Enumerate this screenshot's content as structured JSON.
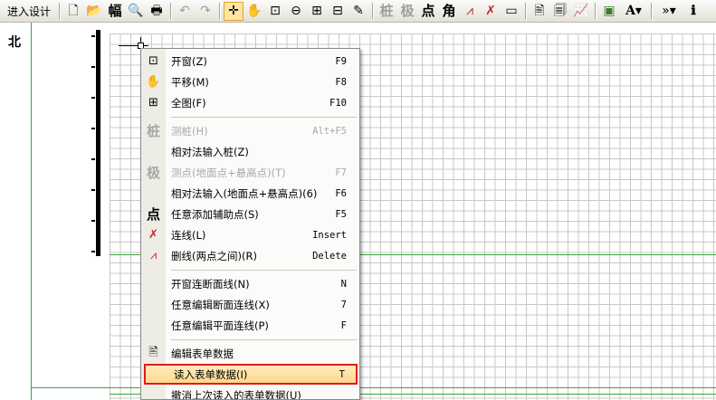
{
  "toolbar": {
    "enter_design_label": "进入设计",
    "buttons": [
      {
        "name": "new-file-icon",
        "glyph": "🗋"
      },
      {
        "name": "open-folder-icon",
        "glyph": "📂"
      },
      {
        "name": "page-format-button",
        "glyph": "幅"
      },
      {
        "name": "print-preview-icon",
        "glyph": "🔍"
      },
      {
        "name": "print-icon",
        "glyph": "🖶"
      },
      {
        "name": "undo-icon",
        "glyph": "↶"
      },
      {
        "name": "redo-icon",
        "glyph": "↷"
      },
      {
        "name": "crosshair-icon",
        "glyph": "✛"
      },
      {
        "name": "pan-hand-icon",
        "glyph": "✋"
      },
      {
        "name": "zoom-window-icon",
        "glyph": "⊡"
      },
      {
        "name": "zoom-out-icon",
        "glyph": "⊖"
      },
      {
        "name": "zoom-extents-icon",
        "glyph": "⊞"
      },
      {
        "name": "full-view-icon",
        "glyph": "⊟"
      },
      {
        "name": "pen-tool-icon",
        "glyph": "✎"
      },
      {
        "name": "pile-button",
        "glyph": "桩"
      },
      {
        "name": "pole-button",
        "glyph": "极"
      },
      {
        "name": "point-button",
        "glyph": "点"
      },
      {
        "name": "angle-button",
        "glyph": "角"
      },
      {
        "name": "delete-line-icon",
        "glyph": "⩘"
      },
      {
        "name": "connect-line-icon",
        "glyph": "✗"
      },
      {
        "name": "ruler-icon",
        "glyph": "▭"
      },
      {
        "name": "edit-table-icon",
        "glyph": "🖹"
      },
      {
        "name": "properties-icon",
        "glyph": "🗐"
      },
      {
        "name": "chart-icon",
        "glyph": "📈"
      },
      {
        "name": "image-icon",
        "glyph": "▣"
      },
      {
        "name": "text-font-icon",
        "glyph": "A▾"
      },
      {
        "name": "more-options-icon",
        "glyph": "»▾"
      },
      {
        "name": "info-icon",
        "glyph": "ℹ"
      }
    ]
  },
  "canvas": {
    "north_label": "北"
  },
  "menu": {
    "items": [
      {
        "icon": "⊡",
        "icon_name": "zoom-window-icon",
        "label": "开窗(Z)",
        "key": "F9",
        "disabled": false
      },
      {
        "icon": "✋",
        "icon_name": "pan-hand-icon",
        "label": "平移(M)",
        "key": "F8",
        "disabled": false
      },
      {
        "icon": "⊞",
        "icon_name": "full-view-icon",
        "label": "全图(F)",
        "key": "F10",
        "disabled": false
      },
      {
        "icon": "桩",
        "icon_name": "pile-icon",
        "label": "测桩(H)",
        "key": "Alt+F5",
        "disabled": true
      },
      {
        "icon": "",
        "icon_name": "",
        "label": "相对法输入桩(Z)",
        "key": "",
        "disabled": false
      },
      {
        "icon": "极",
        "icon_name": "pole-icon",
        "label": "测点(地面点+悬高点)(T)",
        "key": "F7",
        "disabled": true
      },
      {
        "icon": "",
        "icon_name": "",
        "label": "相对法输入(地面点+悬高点)(6)",
        "key": "F6",
        "disabled": false
      },
      {
        "icon": "点",
        "icon_name": "point-icon",
        "label": "任意添加辅助点(S)",
        "key": "F5",
        "disabled": false
      },
      {
        "icon": "✗",
        "icon_name": "connect-line-icon",
        "label": "连线(L)",
        "key": "Insert",
        "disabled": false
      },
      {
        "icon": "⩘",
        "icon_name": "delete-line-icon",
        "label": "删线(两点之间)(R)",
        "key": "Delete",
        "disabled": false
      },
      {
        "icon": "",
        "icon_name": "",
        "label": "开窗连断面线(N)",
        "key": "N",
        "disabled": false
      },
      {
        "icon": "",
        "icon_name": "",
        "label": "任意编辑断面连线(X)",
        "key": "7",
        "disabled": false
      },
      {
        "icon": "",
        "icon_name": "",
        "label": "任意编辑平面连线(P)",
        "key": "F",
        "disabled": false
      },
      {
        "icon": "🖹",
        "icon_name": "edit-table-icon",
        "label": "编辑表单数据",
        "key": "",
        "disabled": false
      },
      {
        "icon": "",
        "icon_name": "",
        "label": "读入表单数据(I)",
        "key": "T",
        "disabled": false,
        "selected": true
      },
      {
        "icon": "",
        "icon_name": "",
        "label": "撤消上次读入的表单数据(U)",
        "key": "",
        "disabled": false
      }
    ]
  }
}
